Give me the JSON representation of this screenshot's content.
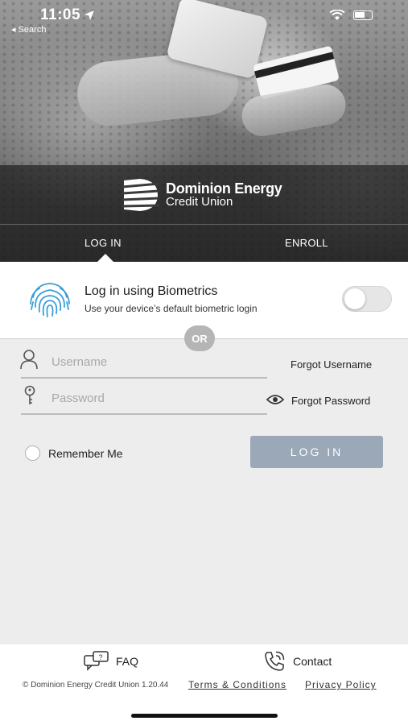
{
  "status_bar": {
    "time": "11:05",
    "back_label": "◂ Search"
  },
  "logo": {
    "line1": "Dominion Energy",
    "line2": "Credit Union"
  },
  "tabs": [
    {
      "label": "LOG IN"
    },
    {
      "label": "ENROLL"
    }
  ],
  "biometrics": {
    "title": "Log in using Biometrics",
    "subtitle": "Use your device’s default biometric login",
    "toggle_on": false
  },
  "divider": {
    "label": "OR"
  },
  "form": {
    "username_placeholder": "Username",
    "password_placeholder": "Password",
    "forgot_username": "Forgot Username",
    "forgot_password": "Forgot Password",
    "remember_me": "Remember Me",
    "login_button": "LOG IN"
  },
  "footer": {
    "faq": "FAQ",
    "contact": "Contact",
    "copyright": "© Dominion Energy Credit Union 1.20.44",
    "terms": "Terms & Conditions",
    "privacy": "Privacy Policy"
  },
  "colors": {
    "login_button_bg": "#9aa8b8",
    "fingerprint": "#3a9fd8",
    "page_bg": "#ededed"
  }
}
